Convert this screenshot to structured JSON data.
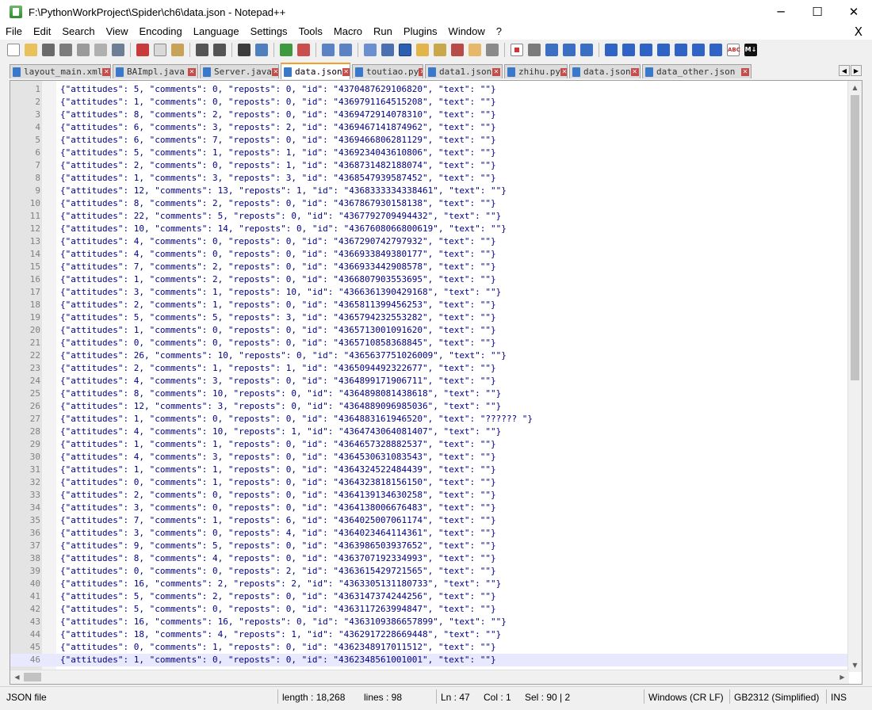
{
  "window": {
    "title": "F:\\PythonWorkProject\\Spider\\ch6\\data.json - Notepad++",
    "minimize": "─",
    "maximize": "☐",
    "close": "✕"
  },
  "menu": {
    "items": [
      "File",
      "Edit",
      "Search",
      "View",
      "Encoding",
      "Language",
      "Settings",
      "Tools",
      "Macro",
      "Run",
      "Plugins",
      "Window",
      "?"
    ],
    "close": "X"
  },
  "toolbar": {
    "icons": [
      "new-file-icon",
      "open-file-icon",
      "save-icon",
      "save-all-icon",
      "close-icon",
      "close-all-icon",
      "print-icon",
      "cut-icon",
      "copy-icon",
      "paste-icon",
      "undo-icon",
      "redo-icon",
      "find-icon",
      "replace-icon",
      "zoom-in-icon",
      "zoom-out-icon",
      "sync-v-icon",
      "sync-h-icon",
      "word-wrap-icon",
      "all-chars-icon",
      "indent-guide-icon",
      "udl-icon",
      "doc-map-icon",
      "function-list-icon",
      "folder-workspace-icon",
      "monitor-icon",
      "record-macro-icon",
      "stop-macro-icon",
      "play-macro-icon",
      "run-macro-multiple-icon",
      "save-macro-icon",
      "bookmark-icon",
      "prev-bookmark-icon",
      "next-bookmark-icon",
      "up-icon",
      "down-icon",
      "fold-icon",
      "unfold-icon",
      "spell-check-icon",
      "markdown-icon"
    ],
    "spell_label": "ABC",
    "md_label": "M↓"
  },
  "tabs": [
    {
      "label": "layout_main.xml",
      "active": false
    },
    {
      "label": "BAImpl.java",
      "active": false
    },
    {
      "label": "Server.java",
      "active": false
    },
    {
      "label": "data.json",
      "active": true
    },
    {
      "label": "toutiao.py",
      "active": false
    },
    {
      "label": "data1.json",
      "active": false
    },
    {
      "label": "zhihu.py",
      "active": false
    },
    {
      "label": "data.json",
      "active": false
    },
    {
      "label": "data_other.json",
      "active": false
    }
  ],
  "tab_scroll": {
    "left": "◀",
    "right": "▶"
  },
  "editor": {
    "current_line": 46,
    "lines": [
      "{\"attitudes\": 5, \"comments\": 0, \"reposts\": 0, \"id\": \"4370487629106820\", \"text\": \"\"}",
      "{\"attitudes\": 1, \"comments\": 0, \"reposts\": 0, \"id\": \"4369791164515208\", \"text\": \"\"}",
      "{\"attitudes\": 8, \"comments\": 2, \"reposts\": 0, \"id\": \"4369472914078310\", \"text\": \"\"}",
      "{\"attitudes\": 6, \"comments\": 3, \"reposts\": 2, \"id\": \"4369467141874962\", \"text\": \"\"}",
      "{\"attitudes\": 6, \"comments\": 7, \"reposts\": 0, \"id\": \"4369466806281129\", \"text\": \"\"}",
      "{\"attitudes\": 5, \"comments\": 1, \"reposts\": 1, \"id\": \"4369234043610806\", \"text\": \"\"}",
      "{\"attitudes\": 2, \"comments\": 0, \"reposts\": 1, \"id\": \"4368731482188074\", \"text\": \"\"}",
      "{\"attitudes\": 1, \"comments\": 3, \"reposts\": 3, \"id\": \"4368547939587452\", \"text\": \"\"}",
      "{\"attitudes\": 12, \"comments\": 13, \"reposts\": 1, \"id\": \"4368333334338461\", \"text\": \"\"}",
      "{\"attitudes\": 8, \"comments\": 2, \"reposts\": 0, \"id\": \"4367867930158138\", \"text\": \"\"}",
      "{\"attitudes\": 22, \"comments\": 5, \"reposts\": 0, \"id\": \"4367792709494432\", \"text\": \"\"}",
      "{\"attitudes\": 10, \"comments\": 14, \"reposts\": 0, \"id\": \"4367608066800619\", \"text\": \"\"}",
      "{\"attitudes\": 4, \"comments\": 0, \"reposts\": 0, \"id\": \"4367290742797932\", \"text\": \"\"}",
      "{\"attitudes\": 4, \"comments\": 0, \"reposts\": 0, \"id\": \"4366933849380177\", \"text\": \"\"}",
      "{\"attitudes\": 7, \"comments\": 2, \"reposts\": 0, \"id\": \"4366933442908578\", \"text\": \"\"}",
      "{\"attitudes\": 1, \"comments\": 2, \"reposts\": 0, \"id\": \"4366807903553695\", \"text\": \"\"}",
      "{\"attitudes\": 3, \"comments\": 1, \"reposts\": 10, \"id\": \"4366361390429168\", \"text\": \"\"}",
      "{\"attitudes\": 2, \"comments\": 1, \"reposts\": 0, \"id\": \"4365811399456253\", \"text\": \"\"}",
      "{\"attitudes\": 5, \"comments\": 5, \"reposts\": 3, \"id\": \"4365794232553282\", \"text\": \"\"}",
      "{\"attitudes\": 1, \"comments\": 0, \"reposts\": 0, \"id\": \"4365713001091620\", \"text\": \"\"}",
      "{\"attitudes\": 0, \"comments\": 0, \"reposts\": 0, \"id\": \"4365710858368845\", \"text\": \"\"}",
      "{\"attitudes\": 26, \"comments\": 10, \"reposts\": 0, \"id\": \"4365637751026009\", \"text\": \"\"}",
      "{\"attitudes\": 2, \"comments\": 1, \"reposts\": 1, \"id\": \"4365094492322677\", \"text\": \"\"}",
      "{\"attitudes\": 4, \"comments\": 3, \"reposts\": 0, \"id\": \"4364899171906711\", \"text\": \"\"}",
      "{\"attitudes\": 8, \"comments\": 10, \"reposts\": 0, \"id\": \"4364898081438618\", \"text\": \"\"}",
      "{\"attitudes\": 12, \"comments\": 3, \"reposts\": 0, \"id\": \"4364889096985036\", \"text\": \"\"}",
      "{\"attitudes\": 1, \"comments\": 0, \"reposts\": 0, \"id\": \"4364883161946520\", \"text\": \"?????? \"}",
      "{\"attitudes\": 4, \"comments\": 10, \"reposts\": 1, \"id\": \"4364743064081407\", \"text\": \"\"}",
      "{\"attitudes\": 1, \"comments\": 1, \"reposts\": 0, \"id\": \"4364657328882537\", \"text\": \"\"}",
      "{\"attitudes\": 4, \"comments\": 3, \"reposts\": 0, \"id\": \"4364530631083543\", \"text\": \"\"}",
      "{\"attitudes\": 1, \"comments\": 1, \"reposts\": 0, \"id\": \"4364324522484439\", \"text\": \"\"}",
      "{\"attitudes\": 0, \"comments\": 1, \"reposts\": 0, \"id\": \"4364323818156150\", \"text\": \"\"}",
      "{\"attitudes\": 2, \"comments\": 0, \"reposts\": 0, \"id\": \"4364139134630258\", \"text\": \"\"}",
      "{\"attitudes\": 3, \"comments\": 0, \"reposts\": 0, \"id\": \"4364138006676483\", \"text\": \"\"}",
      "{\"attitudes\": 7, \"comments\": 1, \"reposts\": 6, \"id\": \"4364025007061174\", \"text\": \"\"}",
      "{\"attitudes\": 3, \"comments\": 0, \"reposts\": 4, \"id\": \"4364023464114361\", \"text\": \"\"}",
      "{\"attitudes\": 9, \"comments\": 5, \"reposts\": 0, \"id\": \"4363986503937652\", \"text\": \"\"}",
      "{\"attitudes\": 8, \"comments\": 4, \"reposts\": 0, \"id\": \"4363707192334993\", \"text\": \"\"}",
      "{\"attitudes\": 0, \"comments\": 0, \"reposts\": 2, \"id\": \"4363615429721565\", \"text\": \"\"}",
      "{\"attitudes\": 16, \"comments\": 2, \"reposts\": 2, \"id\": \"4363305131180733\", \"text\": \"\"}",
      "{\"attitudes\": 5, \"comments\": 2, \"reposts\": 0, \"id\": \"4363147374244256\", \"text\": \"\"}",
      "{\"attitudes\": 5, \"comments\": 0, \"reposts\": 0, \"id\": \"4363117263994847\", \"text\": \"\"}",
      "{\"attitudes\": 16, \"comments\": 16, \"reposts\": 0, \"id\": \"4363109386657899\", \"text\": \"\"}",
      "{\"attitudes\": 18, \"comments\": 4, \"reposts\": 1, \"id\": \"4362917228669448\", \"text\": \"\"}",
      "{\"attitudes\": 0, \"comments\": 1, \"reposts\": 0, \"id\": \"4362348917011512\", \"text\": \"\"}",
      "{\"attitudes\": 1, \"comments\": 0, \"reposts\": 0, \"id\": \"4362348561001001\", \"text\": \"\"}"
    ]
  },
  "scrollbar": {
    "up": "▲",
    "down": "▼",
    "left": "◀",
    "right": "▶"
  },
  "status": {
    "file_type": "JSON file",
    "length": "length : 18,268",
    "lines": "lines : 98",
    "ln": "Ln : 47",
    "col": "Col : 1",
    "sel": "Sel : 90 | 2",
    "eol": "Windows (CR LF)",
    "encoding": "GB2312 (Simplified)",
    "mode": "INS"
  },
  "colors": {
    "tab_accent": "#f4a024",
    "code_text": "#000080",
    "line_numbers": "#808080",
    "current_line": "#e8e8ff"
  }
}
